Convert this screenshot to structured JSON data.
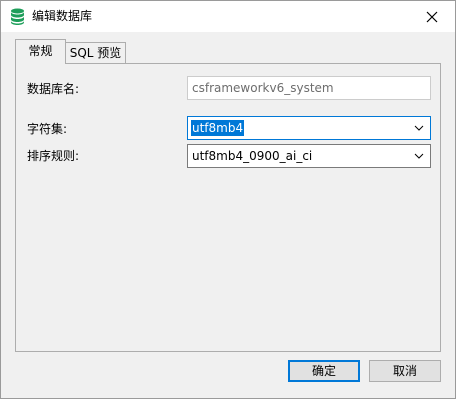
{
  "window": {
    "title": "编辑数据库",
    "icon": "database-icon",
    "close_icon": "close-icon"
  },
  "tabs": [
    {
      "label": "常规",
      "active": true
    },
    {
      "label": "SQL 预览",
      "active": false
    }
  ],
  "form": {
    "db_name": {
      "label": "数据库名:",
      "value": "csframeworkv6_system",
      "readonly": true
    },
    "charset": {
      "label": "字符集:",
      "value": "utf8mb4"
    },
    "collation": {
      "label": "排序规则:",
      "value": "utf8mb4_0900_ai_ci"
    }
  },
  "buttons": {
    "ok": "确定",
    "cancel": "取消"
  },
  "colors": {
    "accent": "#0078d7",
    "db_icon": "#1e9e5a"
  }
}
